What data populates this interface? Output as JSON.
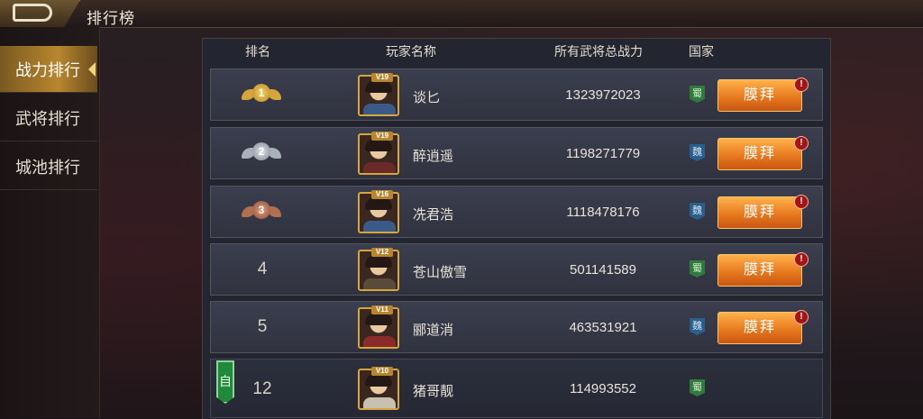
{
  "header": {
    "title": "排行榜"
  },
  "sidebar": {
    "items": [
      {
        "label": "战力排行",
        "active": true
      },
      {
        "label": "武将排行",
        "active": false
      },
      {
        "label": "城池排行",
        "active": false
      }
    ]
  },
  "table": {
    "headers": {
      "rank": "排名",
      "player": "玩家名称",
      "power": "所有武将总战力",
      "nation": "国家"
    },
    "rows": [
      {
        "rank": "1",
        "vip": "V19",
        "name": "谈匕",
        "power": "1323972023",
        "nation": "蜀",
        "action": "膜拜",
        "badge": "!"
      },
      {
        "rank": "2",
        "vip": "V19",
        "name": "醉逍遥",
        "power": "1198271779",
        "nation": "魏",
        "action": "膜拜",
        "badge": "!"
      },
      {
        "rank": "3",
        "vip": "V16",
        "name": "冼君浩",
        "power": "1118478176",
        "nation": "魏",
        "action": "膜拜",
        "badge": "!"
      },
      {
        "rank": "4",
        "vip": "V12",
        "name": "苍山傲雪",
        "power": "501141589",
        "nation": "蜀",
        "action": "膜拜",
        "badge": "!"
      },
      {
        "rank": "5",
        "vip": "V11",
        "name": "郦道消",
        "power": "463531921",
        "nation": "魏",
        "action": "膜拜",
        "badge": "!"
      }
    ],
    "self": {
      "tag": "自",
      "rank": "12",
      "vip": "V10",
      "name": "猪哥靓",
      "power": "114993552",
      "nation": "蜀"
    }
  },
  "colors": {
    "accent": "#e5751c",
    "gold": "#d4a63c",
    "shu": "#2f7a3c",
    "wei": "#2b5e8a"
  }
}
